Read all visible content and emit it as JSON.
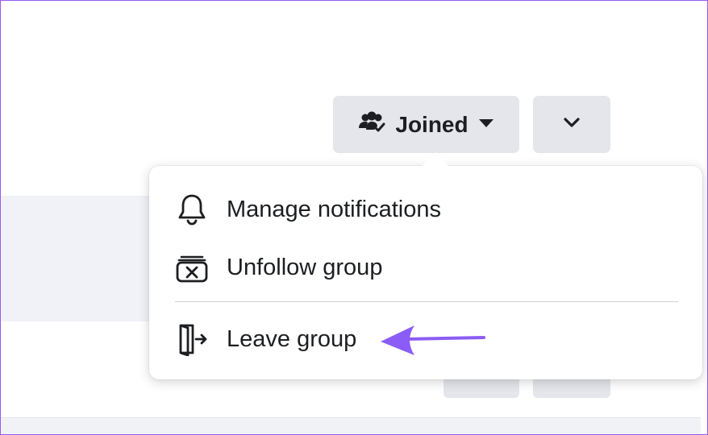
{
  "header": {
    "joined_button": {
      "label": "Joined",
      "icon": "group-members-icon",
      "dropdown_icon": "caret-down-icon"
    },
    "more_button": {
      "icon": "chevron-down-icon"
    }
  },
  "menu": {
    "items": [
      {
        "label": "Manage notifications",
        "icon": "bell-icon"
      },
      {
        "label": "Unfollow group",
        "icon": "unfollow-icon"
      },
      {
        "label": "Leave group",
        "icon": "leave-door-icon"
      }
    ]
  },
  "annotation": {
    "arrow_color": "#8b5cf6",
    "frame_color": "#9b59f0"
  }
}
